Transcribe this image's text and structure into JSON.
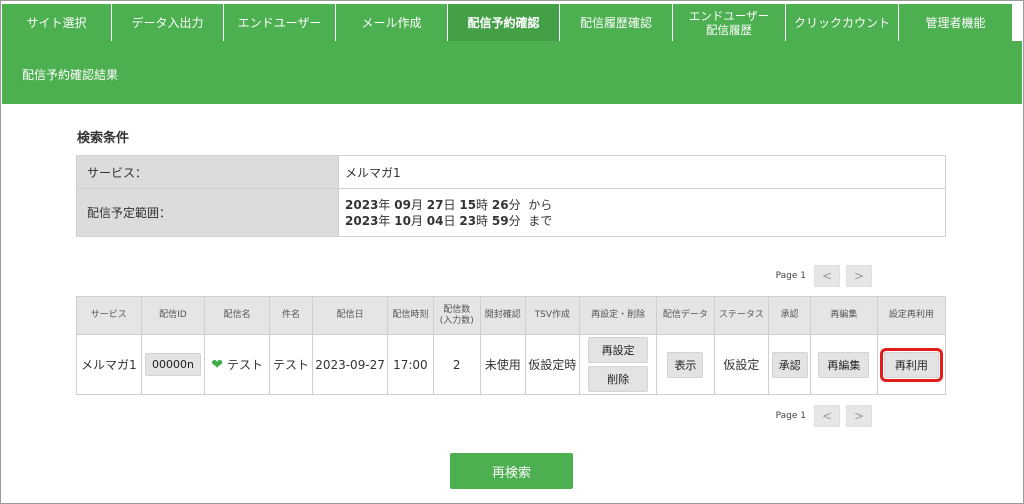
{
  "tabs": [
    {
      "label": "サイト選択"
    },
    {
      "label": "データ入出力"
    },
    {
      "label": "エンドユーザー"
    },
    {
      "label": "メール作成"
    },
    {
      "label": "配信予約確認"
    },
    {
      "label": "配信履歴確認"
    },
    {
      "label": "エンドユーザー配信履歴",
      "line1": "エンドユーザー",
      "line2": "配信履歴"
    },
    {
      "label": "クリックカウント"
    },
    {
      "label": "管理者機能"
    }
  ],
  "header": {
    "title": "配信予約確認結果"
  },
  "search": {
    "title": "検索条件",
    "service_label": "サービス：",
    "service_value": "メルマガ1",
    "range_label": "配信予定範囲：",
    "from": {
      "year": "2023",
      "month": "09",
      "day": "27",
      "hour": "15",
      "minute": "26",
      "suffix": "から"
    },
    "to": {
      "year": "2023",
      "month": "10",
      "day": "04",
      "hour": "23",
      "minute": "59",
      "suffix": "まで"
    },
    "units": {
      "year": "年",
      "month": "月",
      "day": "日",
      "hour": "時",
      "minute": "分"
    }
  },
  "pager": {
    "page_text": "Page 1",
    "prev": "<",
    "next": ">"
  },
  "table": {
    "headers": [
      "サービス",
      "配信ID",
      "配信名",
      "件名",
      "配信日",
      "配信時刻",
      "配信数",
      "(入力数)",
      "開封確認",
      "TSV作成",
      "再設定・削除",
      "配信データ",
      "ステータス",
      "承認",
      "再編集",
      "設定再利用"
    ],
    "row": {
      "service": "メルマガ1",
      "delivery_id": "00000n",
      "delivery_name": "テスト",
      "subject": "テスト",
      "date": "2023-09-27",
      "time": "17:00",
      "count": "2",
      "open_check": "未使用",
      "tsv": "仮設定時",
      "reset_label": "再設定",
      "delete_label": "削除",
      "show_label": "表示",
      "status": "仮設定",
      "approve_label": "承認",
      "reedit_label": "再編集",
      "reuse_label": "再利用"
    }
  },
  "research_label": "再検索",
  "colors": {
    "brand_green": "#4caf50",
    "highlight_red": "#e21b1b"
  }
}
